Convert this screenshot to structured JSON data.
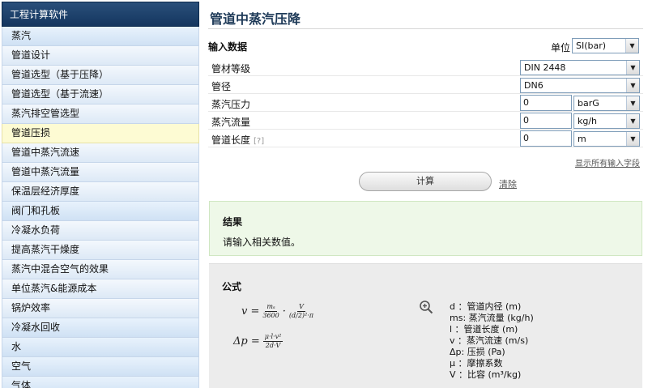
{
  "sidebar": {
    "header": "工程计算软件",
    "items": [
      {
        "label": "蒸汽",
        "cat": true
      },
      {
        "label": "管道设计"
      },
      {
        "label": "管道选型（基于压降）"
      },
      {
        "label": "管道选型（基于流速）"
      },
      {
        "label": "蒸汽排空管选型"
      },
      {
        "label": "管道压损",
        "active": true
      },
      {
        "label": "管道中蒸汽流速"
      },
      {
        "label": "管道中蒸汽流量"
      },
      {
        "label": "保温层经济厚度"
      },
      {
        "label": "阀门和孔板",
        "cat": true
      },
      {
        "label": "冷凝水负荷"
      },
      {
        "label": "提高蒸汽干燥度"
      },
      {
        "label": "蒸汽中混合空气的效果"
      },
      {
        "label": "单位蒸汽&能源成本"
      },
      {
        "label": "锅炉效率"
      },
      {
        "label": "冷凝水回收",
        "cat": true
      },
      {
        "label": "水",
        "cat": true
      },
      {
        "label": "空气",
        "cat": true
      },
      {
        "label": "气体",
        "cat": true
      }
    ]
  },
  "main": {
    "title": "管道中蒸汽压降",
    "input_heading": "输入数据",
    "unit_label": "单位",
    "unit_value": "SI(bar)",
    "rows": {
      "material": {
        "label": "管材等级",
        "value": "DIN 2448"
      },
      "diameter": {
        "label": "管径",
        "value": "DN6"
      },
      "pressure": {
        "label": "蒸汽压力",
        "value": "0",
        "unit": "barG"
      },
      "flow": {
        "label": "蒸汽流量",
        "value": "0",
        "unit": "kg/h"
      },
      "length": {
        "label": "管道长度",
        "hint": "[?]",
        "value": "0",
        "unit": "m"
      }
    },
    "show_all": "显示所有输入字段",
    "calc_button": "计算",
    "clear_link": "清除",
    "results_heading": "结果",
    "results_text": "请输入相关数值。",
    "formula_heading": "公式",
    "formula": {
      "f1_lhs": "v =",
      "f1_frac1_num": "mₛ",
      "f1_frac1_den": "3600",
      "f1_dot": "·",
      "f1_frac2_num": "V",
      "f1_frac2_den": "(d/2)²·π",
      "f2_lhs": "Δp =",
      "f2_frac_num": "μ·l·v²",
      "f2_frac_den": "2d·V"
    },
    "legend": [
      "d ：管道内径 (m)",
      "ms: 蒸汽流量 (kg/h)",
      "l  ：管道长度 (m)",
      "v ：蒸汽流速 (m/s)",
      "Δp: 压损 (Pa)",
      "μ ：摩擦系数",
      "V ：比容 (m³/kg)"
    ]
  }
}
